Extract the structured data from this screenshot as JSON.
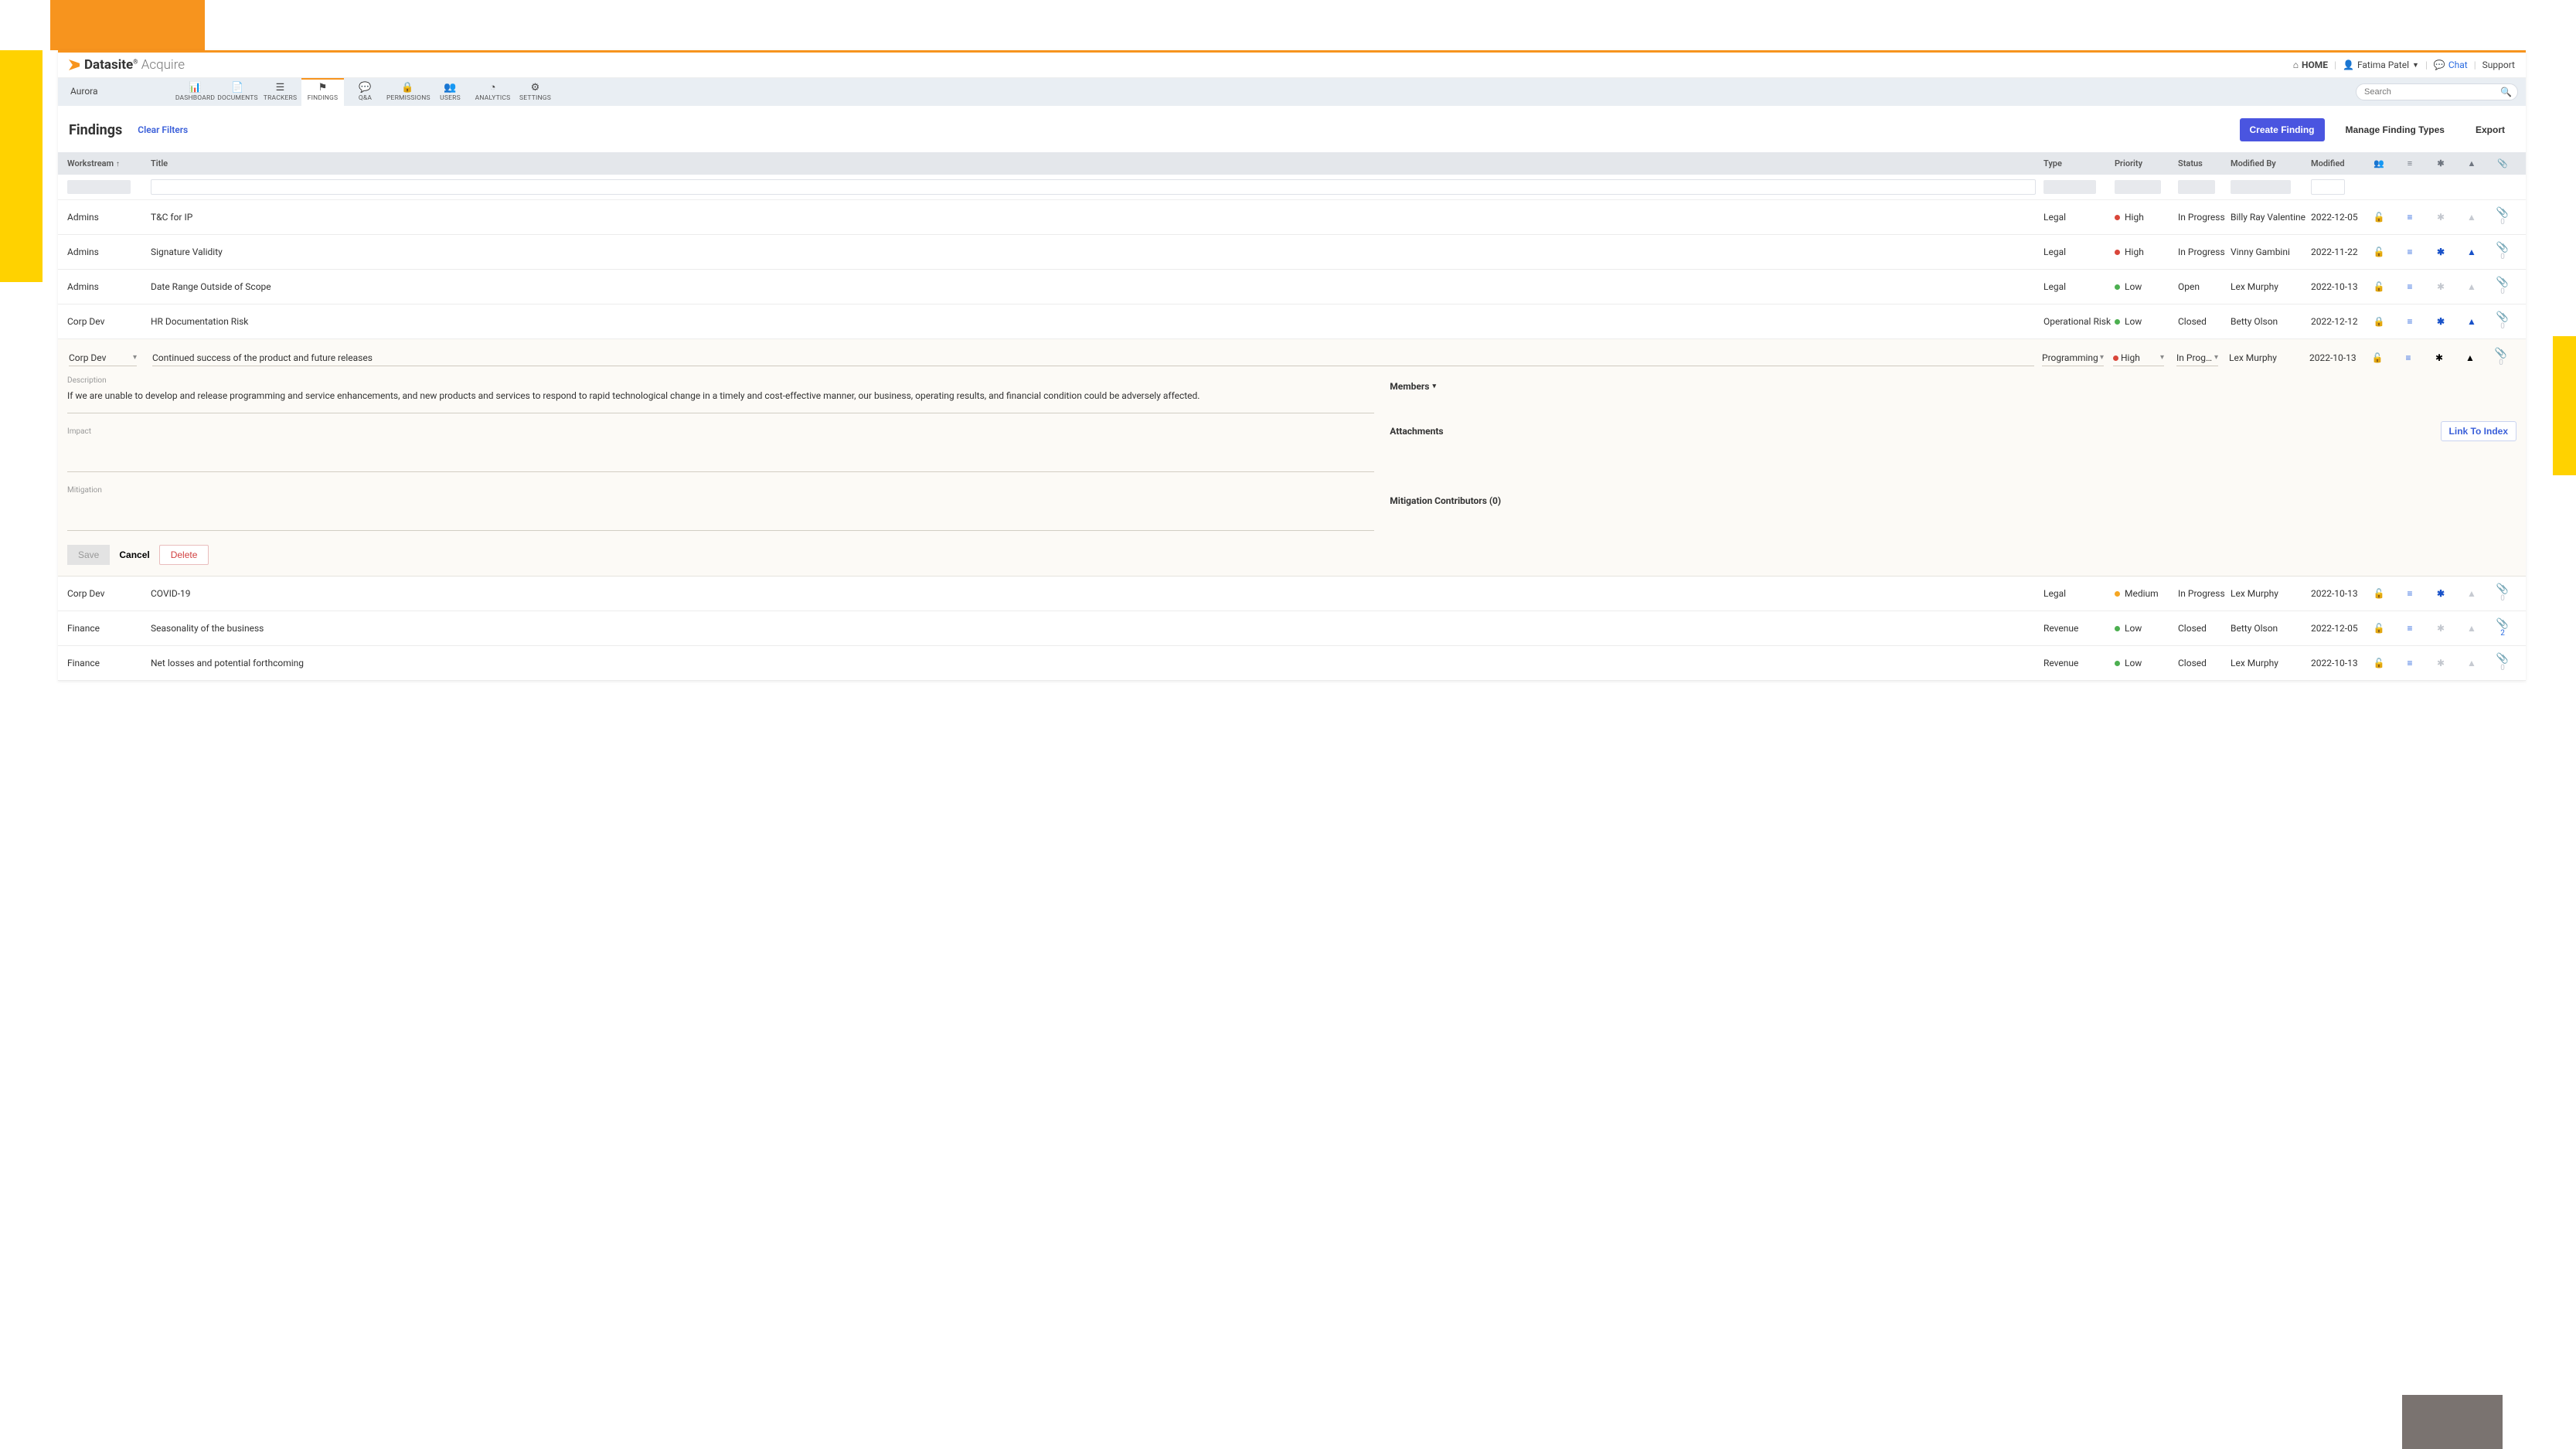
{
  "brand": {
    "name": "Datasite",
    "product": "Acquire"
  },
  "topnav": {
    "home": "HOME",
    "user": "Fatima Patel",
    "chat": "Chat",
    "support": "Support"
  },
  "project": "Aurora",
  "tabs": [
    {
      "label": "DASHBOARD"
    },
    {
      "label": "DOCUMENTS"
    },
    {
      "label": "TRACKERS"
    },
    {
      "label": "FINDINGS",
      "active": true
    },
    {
      "label": "Q&A"
    },
    {
      "label": "PERMISSIONS"
    },
    {
      "label": "USERS"
    },
    {
      "label": "ANALYTICS"
    },
    {
      "label": "SETTINGS"
    }
  ],
  "search": {
    "placeholder": "Search"
  },
  "page": {
    "title": "Findings",
    "clear": "Clear Filters",
    "create": "Create Finding",
    "manage": "Manage Finding Types",
    "export": "Export"
  },
  "columns": {
    "ws": "Workstream",
    "title": "Title",
    "type": "Type",
    "priority": "Priority",
    "status": "Status",
    "modifiedBy": "Modified By",
    "modified": "Modified"
  },
  "rows": [
    {
      "ws": "Admins",
      "title": "T&C for IP",
      "type": "Legal",
      "priority": "High",
      "pcolor": "#d9463a",
      "status": "In Progress",
      "by": "Billy Ray Valentine",
      "mod": "2022-12-05",
      "lock": "unlocked",
      "star": false,
      "warn": false,
      "clip": 0
    },
    {
      "ws": "Admins",
      "title": "Signature Validity",
      "type": "Legal",
      "priority": "High",
      "pcolor": "#d9463a",
      "status": "In Progress",
      "by": "Vinny Gambini",
      "mod": "2022-11-22",
      "lock": "unlocked",
      "star": true,
      "warn": true,
      "clip": 0
    },
    {
      "ws": "Admins",
      "title": "Date Range Outside of Scope",
      "type": "Legal",
      "priority": "Low",
      "pcolor": "#4caf50",
      "status": "Open",
      "by": "Lex Murphy",
      "mod": "2022-10-13",
      "lock": "unlocked",
      "star": false,
      "warn": false,
      "clip": 0
    },
    {
      "ws": "Corp Dev",
      "title": "HR Documentation Risk",
      "type": "Operational Risk",
      "priority": "Low",
      "pcolor": "#4caf50",
      "status": "Closed",
      "by": "Betty Olson",
      "mod": "2022-12-12",
      "lock": "locked",
      "star": true,
      "warn": true,
      "clip": 0
    }
  ],
  "expanded": {
    "ws": "Corp Dev",
    "title": "Continued success of the product and future releases",
    "type": "Programming",
    "priority": "High",
    "pcolor": "#d9463a",
    "status": "In Prog…",
    "by": "Lex Murphy",
    "mod": "2022-10-13",
    "lock": "unlocked",
    "clip": 0,
    "labels": {
      "desc": "Description",
      "impact": "Impact",
      "mitigation": "Mitigation",
      "members": "Members",
      "attachments": "Attachments",
      "mitcontrib": "Mitigation Contributors (0)",
      "link": "Link To Index"
    },
    "desc": "If we are unable to develop and release programming and service enhancements, and new products and services to respond to rapid technological change in a timely and cost-effective manner, our business, operating results, and financial condition could be adversely affected.",
    "actions": {
      "save": "Save",
      "cancel": "Cancel",
      "delete": "Delete"
    }
  },
  "rows2": [
    {
      "ws": "Corp Dev",
      "title": "COVID-19",
      "type": "Legal",
      "priority": "Medium",
      "pcolor": "#f5a623",
      "status": "In Progress",
      "by": "Lex Murphy",
      "mod": "2022-10-13",
      "lock": "unlocked",
      "star": true,
      "warn": false,
      "clip": 0
    },
    {
      "ws": "Finance",
      "title": "Seasonality of the business",
      "type": "Revenue",
      "priority": "Low",
      "pcolor": "#4caf50",
      "status": "Closed",
      "by": "Betty Olson",
      "mod": "2022-12-05",
      "lock": "unlocked",
      "star": false,
      "warn": false,
      "clip": 2,
      "clipon": true
    },
    {
      "ws": "Finance",
      "title": "Net losses and potential forthcoming",
      "type": "Revenue",
      "priority": "Low",
      "pcolor": "#4caf50",
      "status": "Closed",
      "by": "Lex Murphy",
      "mod": "2022-10-13",
      "lock": "unlocked",
      "star": false,
      "warn": false,
      "clip": 0
    }
  ]
}
